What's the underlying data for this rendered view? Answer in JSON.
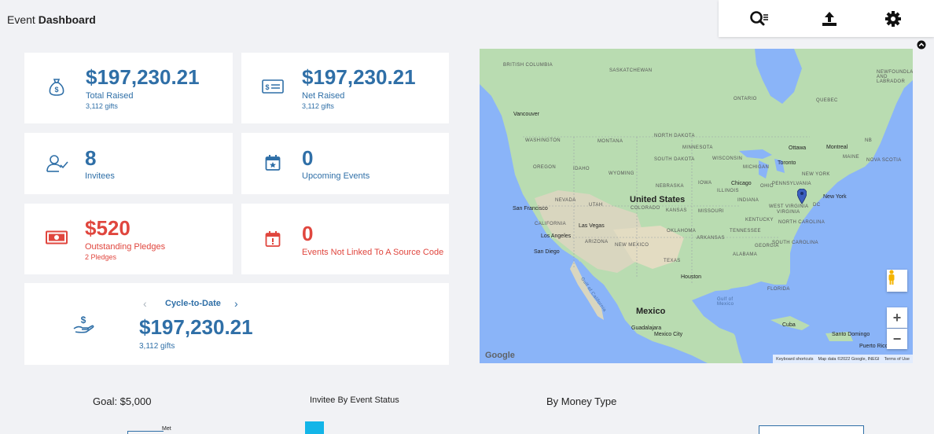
{
  "page": {
    "title_prefix": "Event",
    "title_main": "Dashboard"
  },
  "toolbar": {
    "search_icon": "search-list-icon",
    "upload_icon": "upload-icon",
    "settings_icon": "gear-icon"
  },
  "colors": {
    "accent": "#2f6fa7",
    "alert": "#e0463e",
    "background": "#f1f2f5"
  },
  "cards": {
    "total_raised": {
      "value": "$197,230.21",
      "label": "Total Raised",
      "sub": "3,112 gifts",
      "icon": "money-bag-icon"
    },
    "net_raised": {
      "value": "$197,230.21",
      "label": "Net Raised",
      "sub": "3,112 gifts",
      "icon": "check-icon"
    },
    "invitees": {
      "value": "8",
      "label": "Invitees",
      "icon": "user-check-icon"
    },
    "upcoming": {
      "value": "0",
      "label": "Upcoming Events",
      "icon": "calendar-star-icon"
    },
    "pledges": {
      "value": "$520",
      "label": "Outstanding Pledges",
      "sub": "2 Pledges",
      "icon": "cash-icon"
    },
    "unlinked": {
      "value": "0",
      "label": "Events Not Linked To A Source Code",
      "icon": "calendar-alert-icon"
    }
  },
  "cycle": {
    "label": "Cycle-to-Date",
    "value": "$197,230.21",
    "sub": "3,112 gifts",
    "prev": "‹",
    "next": "›",
    "icon": "hand-money-icon"
  },
  "map": {
    "regions": [
      "BRITISH COLUMBIA",
      "SASKATCHEWAN",
      "NEWFOUNDLAND AND LABRADOR",
      "ONTARIO",
      "QUEBEC",
      "WASHINGTON",
      "MONTANA",
      "NORTH DAKOTA",
      "MINNESOTA",
      "SOUTH DAKOTA",
      "OREGON",
      "IDAHO",
      "WYOMING",
      "WISCONSIN",
      "MICHIGAN",
      "NEW YORK",
      "IOWA",
      "NEBRASKA",
      "ILLINOIS",
      "OHIO",
      "PENNSYLVANIA",
      "NEVADA",
      "UTAH",
      "COLORADO",
      "KANSAS",
      "MISSOURI",
      "INDIANA",
      "WEST VIRGINIA",
      "VIRGINIA",
      "CALIFORNIA",
      "KENTUCKY",
      "NORTH CAROLINA",
      "OKLAHOMA",
      "ARKANSAS",
      "TENNESSEE",
      "SOUTH CAROLINA",
      "ARIZONA",
      "NEW MEXICO",
      "GEORGIA",
      "ALABAMA",
      "TEXAS",
      "FLORIDA",
      "MAINE",
      "NOVA SCOTIA",
      "NB",
      "DC"
    ],
    "cities": [
      "Vancouver",
      "Ottawa",
      "Montreal",
      "Toronto",
      "Chicago",
      "New York",
      "San Francisco",
      "Las Vegas",
      "Los Angeles",
      "San Diego",
      "Houston",
      "Guadalajara",
      "Mexico City",
      "Cuba",
      "Santo Domingo",
      "Puerto Rico"
    ],
    "countries": [
      "United States",
      "Mexico"
    ],
    "water": [
      "Gulf of Mexico",
      "Gulf of California"
    ],
    "footer": [
      "Keyboard shortcuts",
      "Map data ©2022 Google, INEGI",
      "Terms of Use"
    ],
    "logo": "Google",
    "controls": {
      "zoom_in": "+",
      "zoom_out": "−"
    }
  },
  "bottom": {
    "goal": "Goal: $5,000",
    "invitee_status": "Invitee By Event Status",
    "money_type": "By Money Type",
    "met_label": "Met"
  }
}
